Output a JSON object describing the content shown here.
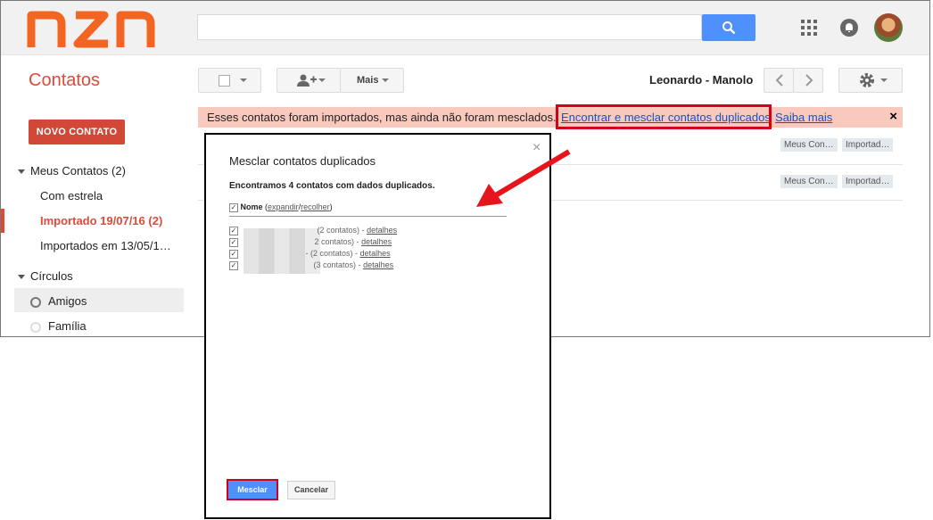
{
  "logo": {
    "text": "nzn",
    "color": "#f26522"
  },
  "search": {
    "placeholder": "",
    "value": ""
  },
  "header": {
    "app_title": "Contatos",
    "more_label": "Mais",
    "owner": "Leonardo - Manolo"
  },
  "sidebar": {
    "new_contact": "NOVO CONTATO",
    "my_contacts": "Meus Contatos (2)",
    "starred": "Com estrela",
    "imported_active": "Importado 19/07/16 (2)",
    "imported_other": "Importados em 13/05/1…",
    "circles": "Círculos",
    "friends": "Amigos",
    "family": "Família"
  },
  "banner": {
    "text": "Esses contatos foram importados, mas ainda não foram mesclados.",
    "merge_link": "Encontrar e mesclar contatos duplicados",
    "learn_more": "Saiba mais",
    "close": "×"
  },
  "rows": [
    {
      "tag1": "Meus Con…",
      "tag2": "Importad…"
    },
    {
      "tag1": "Meus Con…",
      "tag2": "Importad…"
    }
  ],
  "dialog": {
    "title": "Mesclar contatos duplicados",
    "close": "×",
    "subtitle": "Encontramos 4 contatos com dados duplicados.",
    "name_label": "Nome",
    "expand": "expandir",
    "collapse": "recolher",
    "details": "detalhes",
    "entries": [
      {
        "count": "(2 contatos) -"
      },
      {
        "count": "2 contatos) -"
      },
      {
        "count": "- (2 contatos) -"
      },
      {
        "count": "(3 contatos) -"
      }
    ],
    "merge_button": "Mesclar",
    "cancel_button": "Cancelar"
  },
  "colors": {
    "accent_red": "#dd4b39",
    "primary_blue": "#4d90fe",
    "highlight": "#d0021b"
  }
}
